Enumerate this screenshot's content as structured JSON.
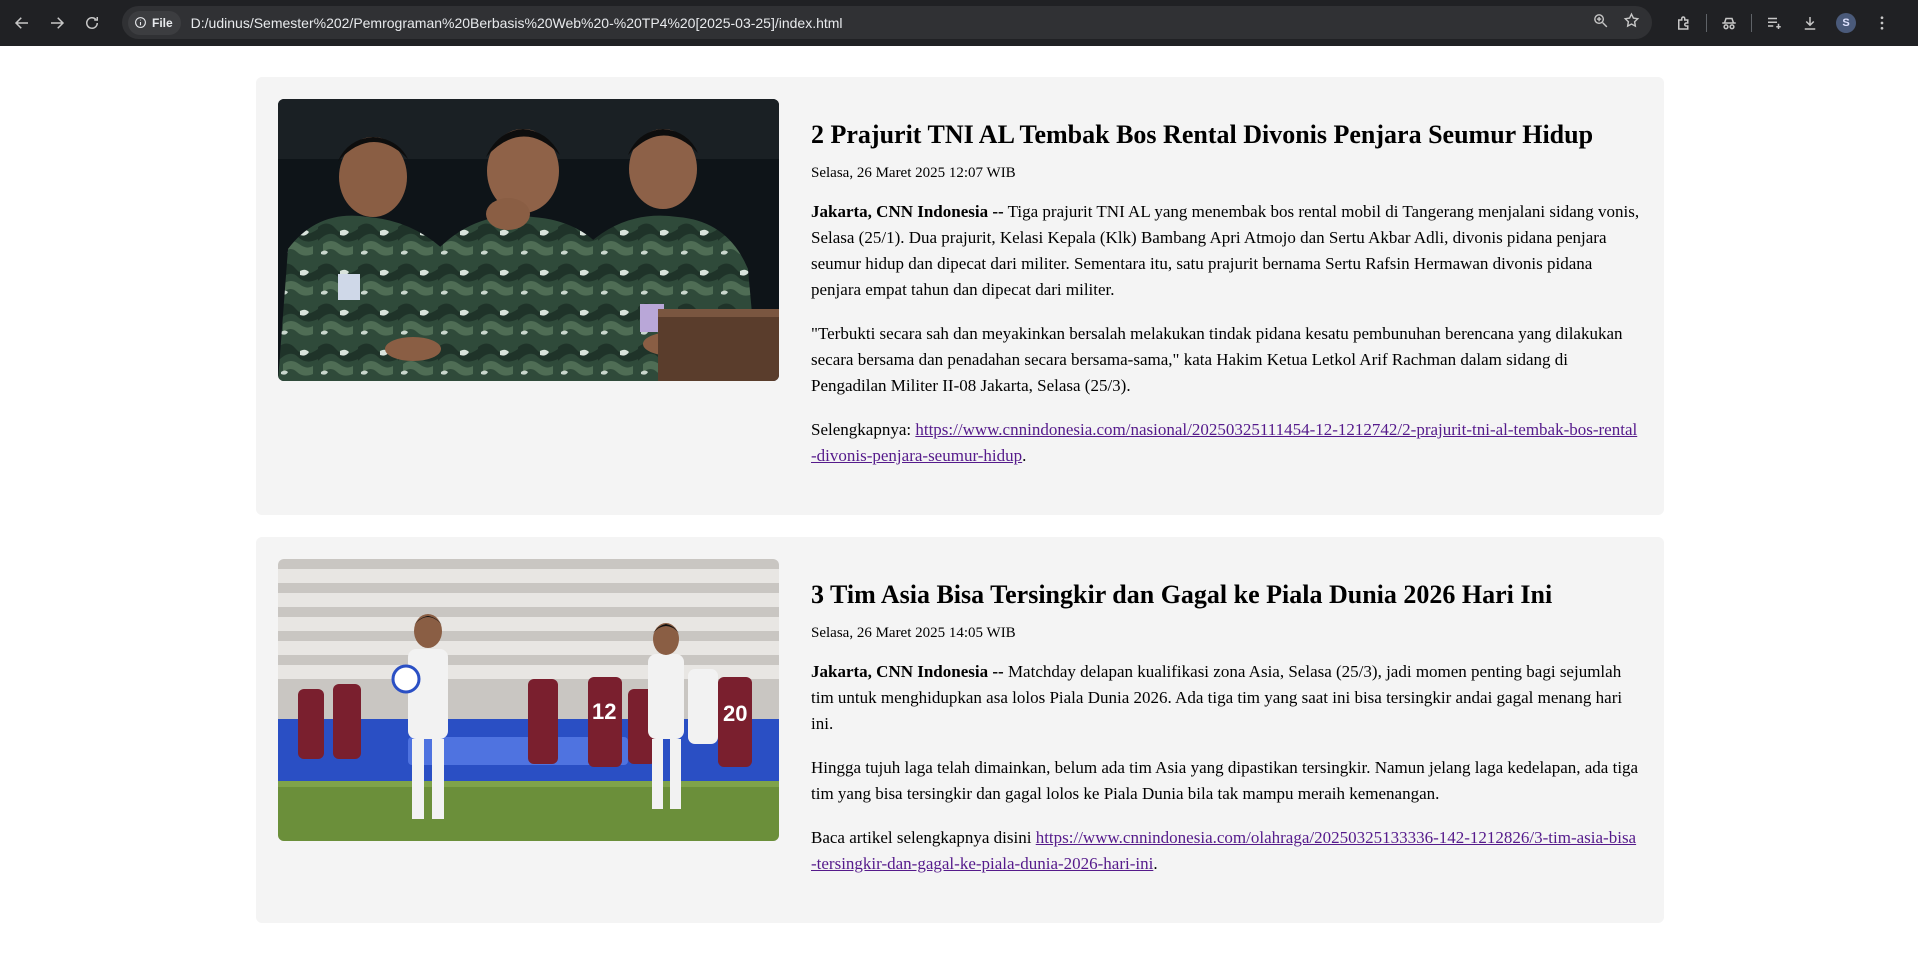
{
  "browser": {
    "file_label": "File",
    "url": "D:/udinus/Semester%202/Pemrograman%20Berbasis%20Web%20-%20TP4%20[2025-03-25]/index.html",
    "profile_initial": "S",
    "icons": [
      "back-icon",
      "forward-icon",
      "reload-icon",
      "info-icon",
      "zoom-icon",
      "bookmark-star-icon",
      "extensions-icon",
      "incognito-icon",
      "reading-list-icon",
      "download-icon",
      "menu-icon"
    ]
  },
  "articles": [
    {
      "title": "2 Prajurit TNI AL Tembak Bos Rental Divonis Penjara Seumur Hidup",
      "date": "Selasa, 26 Maret 2025 12:07 WIB",
      "lead_source": "Jakarta, CNN Indonesia --",
      "lead_text": " Tiga prajurit TNI AL yang menembak bos rental mobil di Tangerang menjalani sidang vonis, Selasa (25/1). Dua prajurit, Kelasi Kepala (Klk) Bambang Apri Atmojo dan Sertu Akbar Adli, divonis pidana penjara seumur hidup dan dipecat dari militer. Sementara itu, satu prajurit bernama Sertu Rafsin Hermawan divonis pidana penjara empat tahun dan dipecat dari militer.",
      "paragraph_2": "\"Terbukti secara sah dan meyakinkan bersalah melakukan tindak pidana kesatu pembunuhan berencana yang dilakukan secara bersama dan penadahan secara bersama-sama,\" kata Hakim Ketua Letkol Arif Rachman dalam sidang di Pengadilan Militer II-08 Jakarta, Selasa (25/3).",
      "more_label": "Selengkapnya: ",
      "more_link": "https://www.cnnindonesia.com/nasional/20250325111454-12-1212742/2-prajurit-tni-al-tembak-bos-rental-divonis-penjara-seumur-hidup",
      "more_suffix": "."
    },
    {
      "title": "3 Tim Asia Bisa Tersingkir dan Gagal ke Piala Dunia 2026 Hari Ini",
      "date": "Selasa, 26 Maret 2025 14:05 WIB",
      "lead_source": "Jakarta, CNN Indonesia --",
      "lead_text": " Matchday delapan kualifikasi zona Asia, Selasa (25/3), jadi momen penting bagi sejumlah tim untuk menghidupkan asa lolos Piala Dunia 2026. Ada tiga tim yang saat ini bisa tersingkir andai gagal menang hari ini.",
      "paragraph_2": "Hingga tujuh laga telah dimainkan, belum ada tim Asia yang dipastikan tersingkir. Namun jelang laga kedelapan, ada tiga tim yang bisa tersingkir dan gagal lolos ke Piala Dunia bila tak mampu meraih kemenangan.",
      "more_label": "Baca artikel selengkapnya disini ",
      "more_link": "https://www.cnnindonesia.com/olahraga/20250325133336-142-1212826/3-tim-asia-bisa-tersingkir-dan-gagal-ke-piala-dunia-2026-hari-ini",
      "more_suffix": "."
    }
  ]
}
